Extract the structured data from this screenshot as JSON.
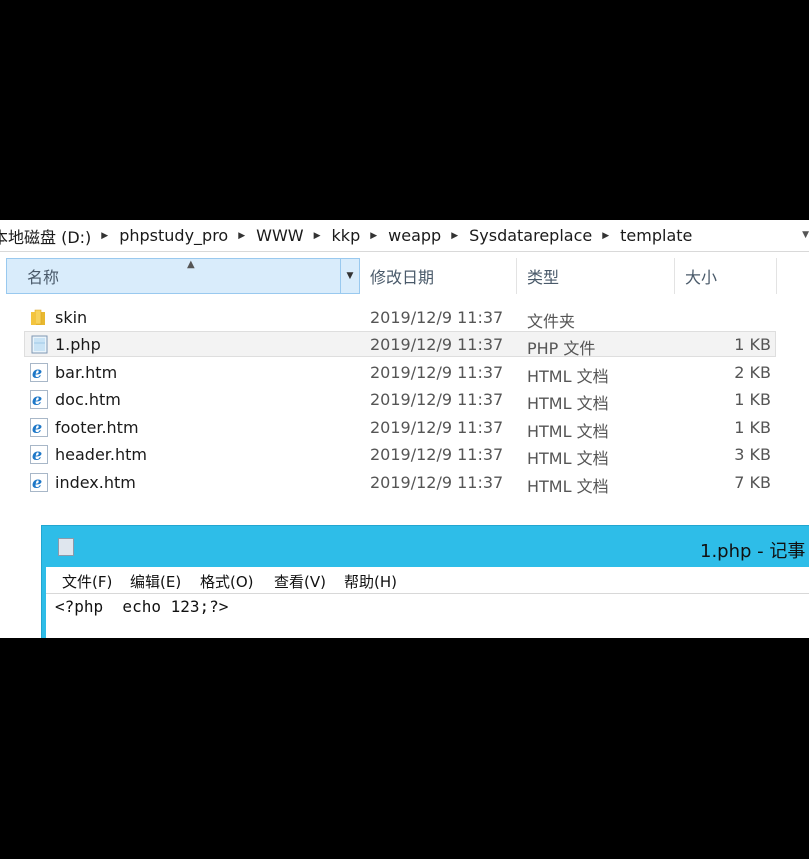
{
  "breadcrumb": [
    "本地磁盘 (D:)",
    "phpstudy_pro",
    "WWW",
    "kkp",
    "weapp",
    "Sysdatareplace",
    "template"
  ],
  "columns": {
    "name": "名称",
    "date": "修改日期",
    "type": "类型",
    "size": "大小"
  },
  "files": [
    {
      "name": "skin",
      "date": "2019/12/9 11:37",
      "type": "文件夹",
      "size": "",
      "icon": "folder-icon"
    },
    {
      "name": "1.php",
      "date": "2019/12/9 11:37",
      "type": "PHP 文件",
      "size": "1 KB",
      "icon": "php-file-icon",
      "selected": true
    },
    {
      "name": "bar.htm",
      "date": "2019/12/9 11:37",
      "type": "HTML 文档",
      "size": "2 KB",
      "icon": "html-file-icon"
    },
    {
      "name": "doc.htm",
      "date": "2019/12/9 11:37",
      "type": "HTML 文档",
      "size": "1 KB",
      "icon": "html-file-icon"
    },
    {
      "name": "footer.htm",
      "date": "2019/12/9 11:37",
      "type": "HTML 文档",
      "size": "1 KB",
      "icon": "html-file-icon"
    },
    {
      "name": "header.htm",
      "date": "2019/12/9 11:37",
      "type": "HTML 文档",
      "size": "3 KB",
      "icon": "html-file-icon"
    },
    {
      "name": "index.htm",
      "date": "2019/12/9 11:37",
      "type": "HTML 文档",
      "size": "7 KB",
      "icon": "html-file-icon"
    }
  ],
  "notepad": {
    "title": "1.php - 记事",
    "menu": [
      "文件(F)",
      "编辑(E)",
      "格式(O)",
      "查看(V)",
      "帮助(H)"
    ],
    "content": "<?php  echo 123;?>"
  },
  "colors": {
    "titlebar": "#2ebde8",
    "selected_header": "#d9ecfb"
  }
}
